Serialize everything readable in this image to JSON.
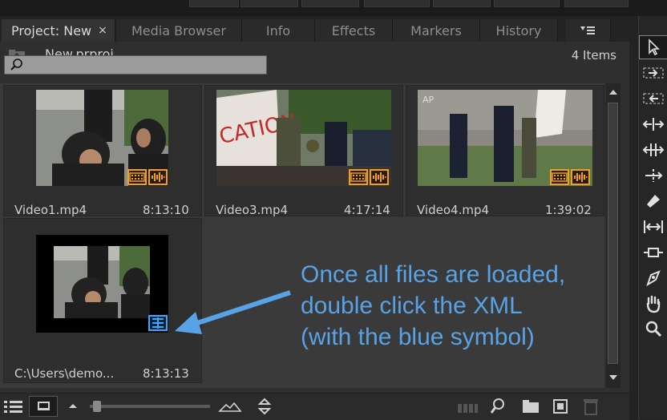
{
  "tabs": [
    {
      "label": "Project: New",
      "close": "×"
    },
    {
      "label": "Media Browser"
    },
    {
      "label": "Info"
    },
    {
      "label": "Effects"
    },
    {
      "label": "Markers"
    },
    {
      "label": "History"
    }
  ],
  "tab_menu_icon": "panel-menu-icon",
  "project": {
    "file_name": "New.prproj",
    "item_count": "4 Items"
  },
  "search": {
    "value": "",
    "icon": "search-icon"
  },
  "items": [
    {
      "name": "Video1.mp4",
      "duration": "8:13:10",
      "badge": "video-audio-badge-icon"
    },
    {
      "name": "Video3.mp4",
      "duration": "4:17:14",
      "badge": "video-audio-badge-icon"
    },
    {
      "name": "Video4.mp4",
      "duration": "1:39:02",
      "badge": "video-audio-badge-icon"
    },
    {
      "name": "C:\\Users\\demo...",
      "duration": "8:13:13",
      "badge": "sequence-xml-badge-icon"
    }
  ],
  "annotation": {
    "lines": [
      "Once all files are loaded,",
      "double click the XML",
      "(with the blue symbol)"
    ],
    "color": "#58a2e6"
  },
  "bottom_toolbar": [
    "list-view-icon",
    "icon-view-icon",
    "zoom-out-icon",
    "zoom-slider",
    "zoom-in-icon",
    "sort-icons-icon",
    "automate-to-sequence-icon",
    "find-icon",
    "new-bin-icon",
    "new-item-icon",
    "clear-trash-icon"
  ],
  "tools": [
    "selection-tool-icon",
    "track-select-forward-icon",
    "track-select-backward-icon",
    "ripple-edit-icon",
    "rolling-edit-icon",
    "rate-stretch-icon",
    "razor-icon",
    "slip-icon",
    "slide-icon",
    "pen-icon",
    "hand-icon",
    "zoom-icon"
  ],
  "colors": {
    "badge_orange": "#f0a020",
    "badge_blue": "#3aa8ff",
    "panel_bg": "#2f2f2f"
  }
}
